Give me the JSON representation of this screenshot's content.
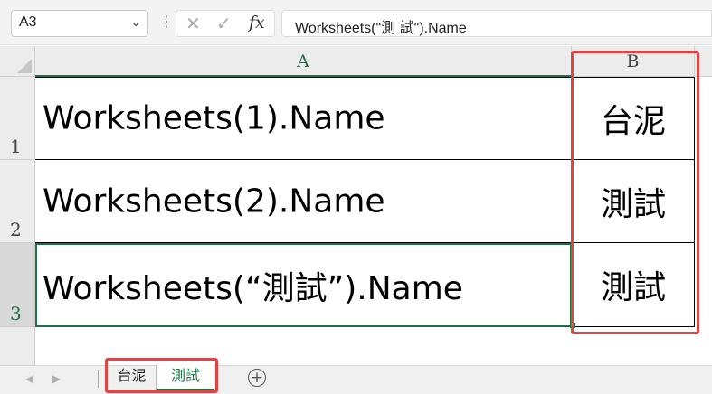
{
  "formula_bar": {
    "name_box": "A3",
    "name_box_chevron": "⌄",
    "dots": "⋮",
    "cancel_glyph": "✕",
    "enter_glyph": "✓",
    "fx_label": "fx",
    "formula": "Worksheets(\"測 試\").Name"
  },
  "columns": [
    "A",
    "B"
  ],
  "rows": [
    {
      "number": "1",
      "a": "Worksheets(1).Name",
      "b": "台泥"
    },
    {
      "number": "2",
      "a": "Worksheets(2).Name",
      "b": "測試"
    },
    {
      "number": "3",
      "a": "Worksheets(“測試”).Name",
      "b": "測試"
    }
  ],
  "sheet_tabs": {
    "prev": "◀",
    "next": "▶",
    "tabs": [
      "台泥",
      "測試"
    ],
    "active_tab": "測試",
    "add_sheet": "+"
  },
  "colors": {
    "accent_green": "#1e7145",
    "highlight_red": "#e04545"
  }
}
